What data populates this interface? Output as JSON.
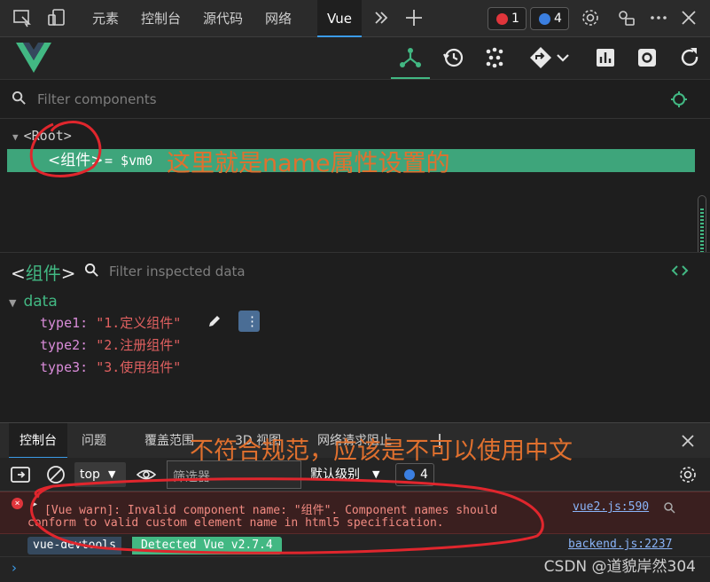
{
  "tabbar": {
    "tabs": [
      "元素",
      "控制台",
      "源代码",
      "网络",
      "Vue"
    ],
    "active_tab": "Vue",
    "error_count": "1",
    "message_count": "4"
  },
  "vue_toolbar": {
    "icons": [
      "vue-logo-icon",
      "components-icon",
      "timeline-icon",
      "pinia-icon",
      "router-icon",
      "chevron-down-icon",
      "performance-icon",
      "settings-icon",
      "refresh-icon"
    ]
  },
  "components": {
    "filter_placeholder": "Filter components",
    "root": "<Root>",
    "selected_open": "<",
    "selected_name": "组件",
    "selected_close": ">",
    "selected_vm": "= $vm0"
  },
  "inspector": {
    "title_open": "<",
    "title_name": "组件",
    "title_close": ">",
    "filter_placeholder": "Filter inspected data",
    "section": "data",
    "props": [
      {
        "key": "type1:",
        "value": "\"1.定义组件\""
      },
      {
        "key": "type2:",
        "value": "\"2.注册组件\""
      },
      {
        "key": "type3:",
        "value": "\"3.使用组件\""
      }
    ]
  },
  "drawer": {
    "tabs": [
      "控制台",
      "问题",
      "覆盖范围",
      "3D 视图",
      "网络请求阻止"
    ],
    "context": "top",
    "filter_placeholder": "筛选器",
    "level": "默认级别",
    "message_count": "4"
  },
  "console": {
    "error_line1": "[Vue warn]: Invalid component name: \"组件\". Component names should",
    "error_line2": "conform to valid custom element name in html5 specification.",
    "error_source": "vue2.js:590",
    "tag_devtools": "vue-devtools",
    "tag_detected": "Detected Vue v2.7.4",
    "info_source": "backend.js:2237"
  },
  "annotations": {
    "name_note": "这里就是name属性设置的",
    "spec_note": "不符合规范，应该是不可以使用中文"
  },
  "watermark": "CSDN @道貌岸然304",
  "colors": {
    "vue_green": "#42b883",
    "selection_green": "#3ea57b",
    "annotation_red": "#e0262d",
    "annotation_orange": "#e0702e",
    "error_bg": "#3a1f1f"
  }
}
